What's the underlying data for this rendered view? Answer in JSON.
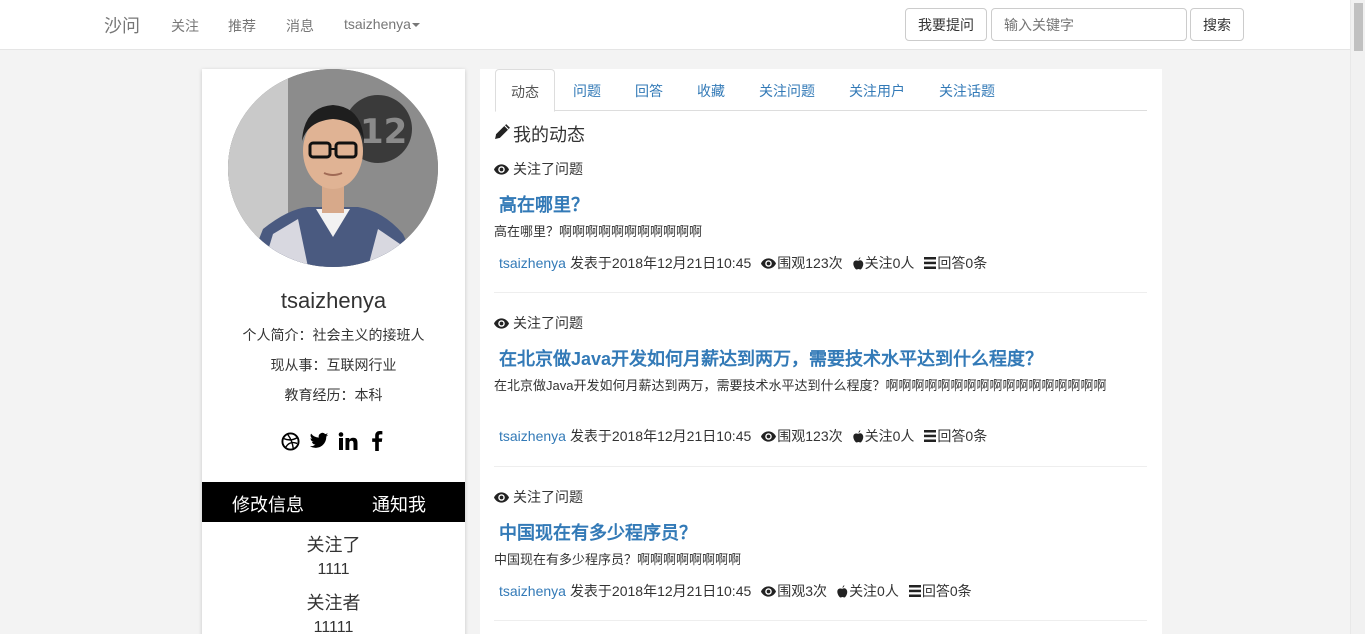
{
  "navbar": {
    "brand": "沙问",
    "links": [
      "关注",
      "推荐",
      "消息"
    ],
    "user": "tsaizhenya",
    "ask_button": "我要提问",
    "search_placeholder": "输入关键字",
    "search_button": "搜索"
  },
  "profile": {
    "username": "tsaizhenya",
    "bio": "个人简介：社会主义的接班人",
    "occupation": "现从事：互联网行业",
    "education": "教育经历：本科",
    "socials": [
      "dribbble-icon",
      "twitter-icon",
      "linkedin-icon",
      "facebook-icon"
    ],
    "edit_button": "修改信息",
    "notify_button": "通知我",
    "following_label": "关注了",
    "following_count": "1111",
    "followers_label": "关注者",
    "followers_count": "11111"
  },
  "tabs": [
    "动态",
    "问题",
    "回答",
    "收藏",
    "关注问题",
    "关注用户",
    "关注话题"
  ],
  "active_tab": "动态",
  "section_title": "我的动态",
  "feed": [
    {
      "activity": "关注了问题",
      "title": "高在哪里？",
      "body": "高在哪里？啊啊啊啊啊啊啊啊啊啊啊",
      "author": "tsaizhenya",
      "posted": "发表于2018年12月21日10:45",
      "views": "围观123次",
      "follows": "关注0人",
      "answers": "回答0条"
    },
    {
      "activity": "关注了问题",
      "title": "在北京做Java开发如何月薪达到两万，需要技术水平达到什么程度？",
      "body": "在北京做Java开发如何月薪达到两万，需要技术水平达到什么程度？啊啊啊啊啊啊啊啊啊啊啊啊啊啊啊啊啊",
      "author": "tsaizhenya",
      "posted": "发表于2018年12月21日10:45",
      "views": "围观123次",
      "follows": "关注0人",
      "answers": "回答0条"
    },
    {
      "activity": "关注了问题",
      "title": "中国现在有多少程序员？",
      "body": "中国现在有多少程序员？啊啊啊啊啊啊啊啊",
      "author": "tsaizhenya",
      "posted": "发表于2018年12月21日10:45",
      "views": "围观3次",
      "follows": "关注0人",
      "answers": "回答0条"
    }
  ],
  "colors": {
    "link": "#337ab7",
    "bar": "#000000",
    "background": "#f3f3f3"
  }
}
